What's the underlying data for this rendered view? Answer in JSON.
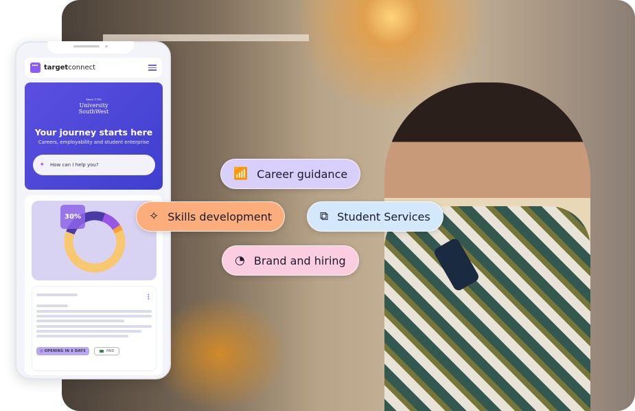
{
  "app": {
    "brand_bold": "target",
    "brand_light": "connect"
  },
  "hero": {
    "university_since": "Since 1765",
    "university_name_1": "University",
    "university_name_2": "SouthWest",
    "title": "Your journey starts here",
    "subtitle": "Careers, employability and student enterprise",
    "search_placeholder": "How can I help you?"
  },
  "stats": {
    "percent_label": "30%",
    "donut": [
      {
        "value": 62,
        "color": "#f8c870"
      },
      {
        "value": 25,
        "color": "#4b3aa6"
      },
      {
        "value": 10,
        "color": "#9b55e6"
      },
      {
        "value": 3,
        "color": "#f7a035"
      }
    ]
  },
  "job_card": {
    "status": "OPENING IN 6 DAYS",
    "pay": "PAID"
  },
  "chips": [
    {
      "label": "Career guidance",
      "icon": "bar-chart-icon",
      "color": "#d8d0fb"
    },
    {
      "label": "Skills development",
      "icon": "sparkles-icon",
      "color": "#fbad7c"
    },
    {
      "label": "Student Services",
      "icon": "line-chart-icon",
      "color": "#d4e8fb"
    },
    {
      "label": "Brand and hiring",
      "icon": "pie-chart-icon",
      "color": "#fbcde0"
    }
  ]
}
